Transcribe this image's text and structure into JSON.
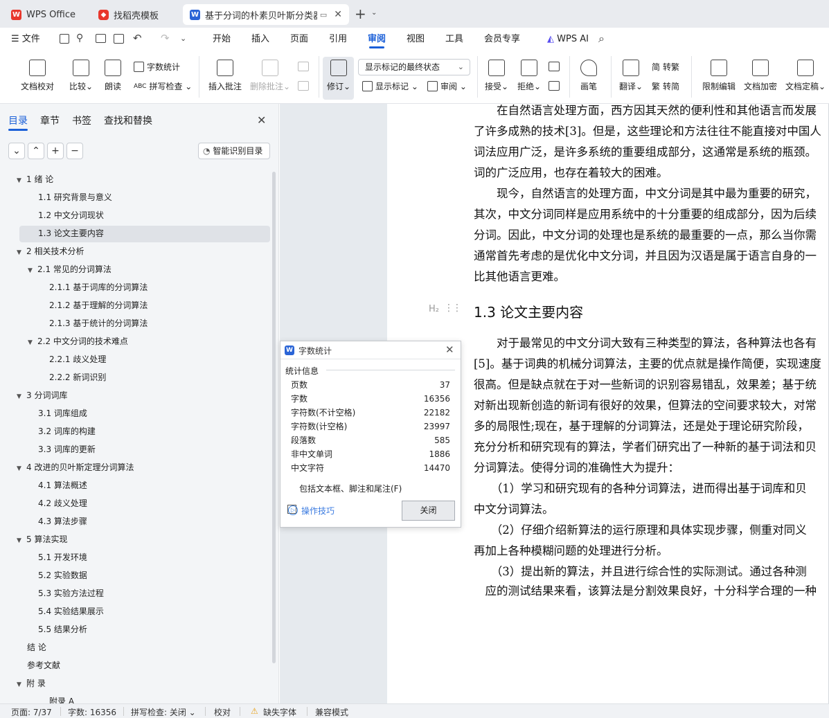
{
  "tabs": [
    {
      "label": "WPS Office"
    },
    {
      "label": "找稻壳模板"
    },
    {
      "label": "基于分词的朴素贝叶斯分类器的"
    }
  ],
  "menu": [
    "文件",
    "开始",
    "插入",
    "页面",
    "引用",
    "审阅",
    "视图",
    "工具",
    "会员专享",
    "WPS AI"
  ],
  "ribbon": {
    "doc_check": "文档校对",
    "compare": "比较",
    "read_aloud": "朗读",
    "word_count": "字数统计",
    "spell_check": "拼写检查",
    "insert_comment": "插入批注",
    "delete_comment": "删除批注",
    "track_changes": "修订",
    "display_mode": "显示标记的最终状态",
    "show_markup": "显示标记",
    "review_pane": "审阅",
    "accept": "接受",
    "reject": "拒绝",
    "pen": "画笔",
    "translate": "翻译",
    "to_traditional": "转繁",
    "to_simplified": "转简",
    "restrict_edit": "限制编辑",
    "encrypt": "文档加密",
    "finalize": "文档定稿"
  },
  "nav": {
    "tabs": [
      "目录",
      "章节",
      "书签",
      "查找和替换"
    ],
    "smart_toc": "智能识别目录",
    "items": [
      {
        "label": "1  绪  论"
      },
      {
        "label": "1.1 研究背景与意义"
      },
      {
        "label": "1.2 中文分词现状"
      },
      {
        "label": "1.3  论文主要内容"
      },
      {
        "label": "2 相关技术分析"
      },
      {
        "label": "2.1 常见的分词算法"
      },
      {
        "label": "2.1.1 基于词库的分词算法"
      },
      {
        "label": "2.1.2 基于理解的分词算法"
      },
      {
        "label": "2.1.3 基于统计的分词算法"
      },
      {
        "label": "2.2 中文分词的技术难点"
      },
      {
        "label": "2.2.1 歧义处理"
      },
      {
        "label": "2.2.2 新词识别"
      },
      {
        "label": "3 分词词库"
      },
      {
        "label": "3.1 词库组成"
      },
      {
        "label": "3.2 词库的构建"
      },
      {
        "label": "3.3 词库的更新"
      },
      {
        "label": "4  改进的贝叶斯定理分词算法"
      },
      {
        "label": "4.1 算法概述"
      },
      {
        "label": "4.2 歧义处理"
      },
      {
        "label": "4.3 算法步骤"
      },
      {
        "label": "5  算法实现"
      },
      {
        "label": "5.1 开发环境"
      },
      {
        "label": "5.2 实验数据"
      },
      {
        "label": "5.3 实验方法过程"
      },
      {
        "label": "5.4 实验结果展示"
      },
      {
        "label": "5.5 结果分析"
      },
      {
        "label": "结  论"
      },
      {
        "label": "参考文献"
      },
      {
        "label": "附  录"
      },
      {
        "label": "附录 A"
      }
    ]
  },
  "doc": {
    "lines": [
      "　　在自然语言处理方面，西方因其天然的便利性和其他语言而发展",
      "了许多成熟的技术[3]。但是，这些理论和方法往往不能直接对中国人",
      "词法应用广泛，是许多系统的重要组成部分，这通常是系统的瓶颈。",
      "词的广泛应用，也存在着较大的困难。",
      "　　现今，自然语言的处理方面，中文分词是其中最为重要的研究，",
      "其次，中文分词同样是应用系统中的十分重要的组成部分，因为后续",
      "分词。因此，中文分词的处理也是系统的最重要的一点，那么当你需",
      "通常首先考虑的是优化中文分词，并且因为汉语是属于语言自身的一",
      "比其他语言更难。"
    ],
    "heading_marker": "H₂",
    "heading": "1.3  论文主要内容",
    "lines2": [
      "　　对于最常见的中文分词大致有三种类型的算法，各种算法也各有",
      "[5]。基于词典的机械分词算法，主要的优点就是操作简便，实现速度",
      "很高。但是缺点就在于对一些新词的识别容易错乱，效果差；基于统",
      "对新出现新创造的新词有很好的效果，但算法的空间要求较大，对常",
      "多的局限性;现在，基于理解的分词算法，还是处于理论研究阶段，",
      "充分分析和研究现有的算法，学者们研究出了一种新的基于词法和贝",
      "分词算法。使得分词的准确性大为提升：",
      "　　（1）学习和研究现有的各种分词算法，进而得出基于词库和贝",
      "中文分词算法。",
      "　　（2）仔细介绍新算法的运行原理和具体实现步骤，侧重对同义",
      "再加上各种模糊问题的处理进行分析。",
      "　　（3）提出新的算法，并且进行综合性的实际测试。通过各种测",
      "　应的测试结果来看，该算法是分割效果良好，十分科学合理的一种"
    ]
  },
  "dialog": {
    "title": "字数统计",
    "section": "统计信息",
    "rows": [
      {
        "label": "页数",
        "value": "37"
      },
      {
        "label": "字数",
        "value": "16356"
      },
      {
        "label": "字符数(不计空格)",
        "value": "22182"
      },
      {
        "label": "字符数(计空格)",
        "value": "23997"
      },
      {
        "label": "段落数",
        "value": "585"
      },
      {
        "label": "非中文单词",
        "value": "1886"
      },
      {
        "label": "中文字符",
        "value": "14470"
      }
    ],
    "checkbox": "包括文本框、脚注和尾注(F)",
    "tips": "操作技巧",
    "close": "关闭"
  },
  "status": {
    "page": "页面: 7/37",
    "words": "字数: 16356",
    "spell": "拼写检查: 关闭",
    "proof": "校对",
    "missing_font": "缺失字体",
    "compat": "兼容模式"
  },
  "colors": {
    "accent": "#1a5fd8",
    "wps_red": "#e8372c"
  }
}
